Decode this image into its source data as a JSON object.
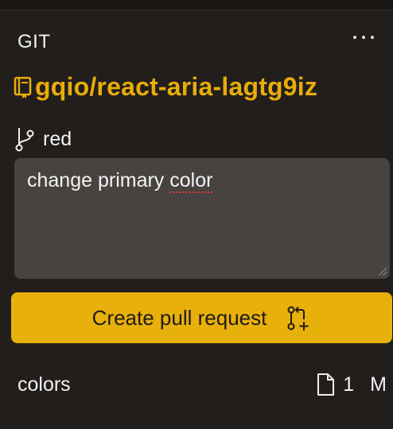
{
  "panel": {
    "title": "GIT",
    "more_icon": "more-horizontal-icon"
  },
  "repo": {
    "icon": "repo-book-icon",
    "name": "gqio/react-aria-lagtg9iz",
    "color": "#e8ac0a"
  },
  "branch": {
    "icon": "git-branch-icon",
    "name": "red"
  },
  "commit": {
    "message_prefix": "change primary ",
    "message_misspelled": "color"
  },
  "actions": {
    "create_pr_label": "Create pull request",
    "create_pr_icon": "git-pull-request-create-icon",
    "button_color": "#e8b00b"
  },
  "changes": {
    "folder": "colors",
    "file_icon": "file-icon",
    "count": "1",
    "status": "M"
  }
}
